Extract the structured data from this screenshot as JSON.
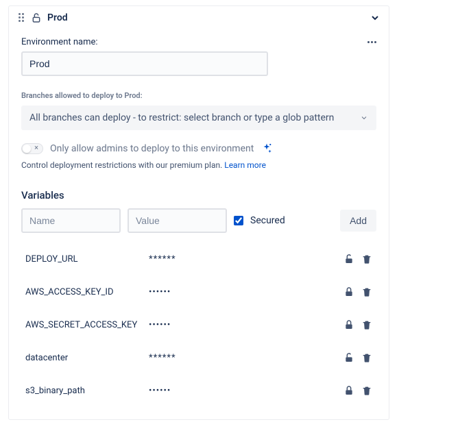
{
  "header": {
    "title": "Prod"
  },
  "environment": {
    "name_label": "Environment name:",
    "name_value": "Prod"
  },
  "branches": {
    "label": "Branches allowed to deploy to Prod:",
    "selected": "All branches can deploy - to restrict: select branch or type a glob pattern"
  },
  "admin_toggle": {
    "label": "Only allow admins to deploy to this environment"
  },
  "premium": {
    "text": "Control deployment restrictions with our premium plan. ",
    "link_text": "Learn more"
  },
  "variables": {
    "title": "Variables",
    "name_placeholder": "Name",
    "value_placeholder": "Value",
    "secured_label": "Secured",
    "add_button": "Add",
    "items": [
      {
        "name": "DEPLOY_URL",
        "value": "******",
        "locked": false
      },
      {
        "name": "AWS_ACCESS_KEY_ID",
        "value": "••••••",
        "locked": true
      },
      {
        "name": "AWS_SECRET_ACCESS_KEY",
        "value": "••••••",
        "locked": true
      },
      {
        "name": "datacenter",
        "value": "******",
        "locked": false
      },
      {
        "name": "s3_binary_path",
        "value": "••••••",
        "locked": true
      }
    ]
  }
}
